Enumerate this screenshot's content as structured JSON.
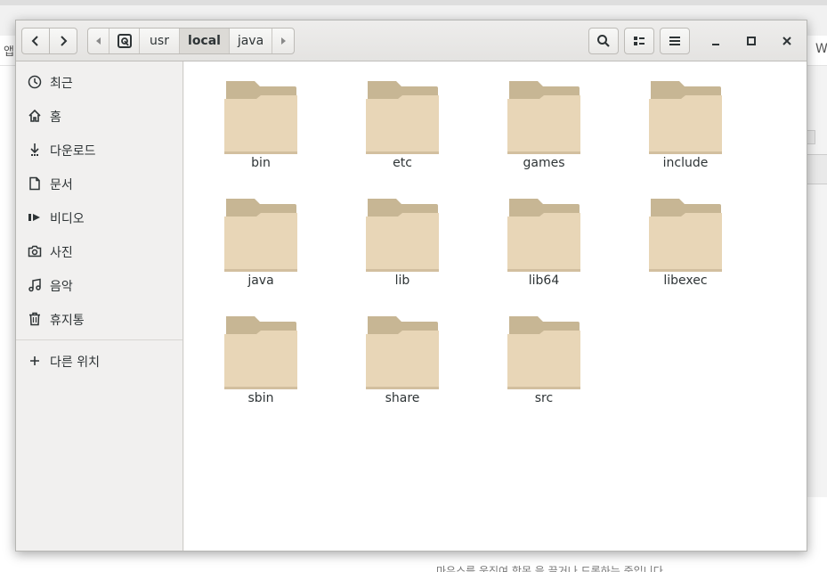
{
  "background": {
    "bookmarks_left": "앱",
    "bookmarks_right": "W",
    "bottom_text": "마우스를 움직여 항목 을 끌거나 드롭하는 중입니다"
  },
  "header": {
    "back_icon": "chevron-left-icon",
    "forward_icon": "chevron-right-icon",
    "path": {
      "root_icon": "drive-icon",
      "segments": [
        "usr",
        "local",
        "java"
      ],
      "current": "local"
    },
    "search_icon": "search-icon",
    "view_icon": "list-view-icon",
    "menu_icon": "hamburger-icon",
    "minimize_icon": "minimize-icon",
    "maximize_icon": "maximize-icon",
    "close_icon": "close-icon"
  },
  "sidebar": {
    "items": [
      {
        "label": "최근",
        "icon": "clock-icon"
      },
      {
        "label": "홈",
        "icon": "home-icon"
      },
      {
        "label": "다운로드",
        "icon": "download-icon"
      },
      {
        "label": "문서",
        "icon": "document-icon"
      },
      {
        "label": "비디오",
        "icon": "video-icon"
      },
      {
        "label": "사진",
        "icon": "camera-icon"
      },
      {
        "label": "음악",
        "icon": "music-icon"
      },
      {
        "label": "휴지통",
        "icon": "trash-icon"
      }
    ],
    "other_locations": {
      "label": "다른 위치",
      "icon": "plus-icon"
    }
  },
  "folders": [
    "bin",
    "etc",
    "games",
    "include",
    "java",
    "lib",
    "lib64",
    "libexec",
    "sbin",
    "share",
    "src"
  ],
  "colors": {
    "folder_body": "#e8d6b7",
    "folder_tab": "#c7b694"
  }
}
